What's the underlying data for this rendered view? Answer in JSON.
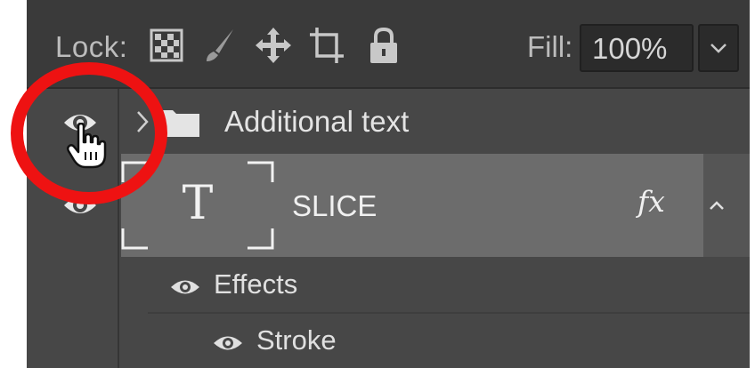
{
  "lock_bar": {
    "lock_label": "Lock:",
    "lock_icons": [
      "lock-transparent-pixels-icon",
      "lock-image-pixels-icon",
      "lock-position-icon",
      "lock-artboard-icon",
      "lock-all-icon"
    ],
    "fill_label": "Fill:",
    "fill_value": "100%"
  },
  "layers": [
    {
      "type": "group",
      "name": "Additional text",
      "visible": true,
      "expanded": false
    },
    {
      "type": "text",
      "name": "SLICE",
      "visible": true,
      "selected": true,
      "fx_label": "fx",
      "effects": {
        "label": "Effects",
        "items": [
          {
            "label": "Stroke"
          }
        ]
      }
    }
  ],
  "annotation": {
    "highlight_color": "#ee1212"
  },
  "colors": {
    "panel": "#474747",
    "selected_row": "#6c6c6c",
    "toolbar": "#3a3a3a"
  }
}
